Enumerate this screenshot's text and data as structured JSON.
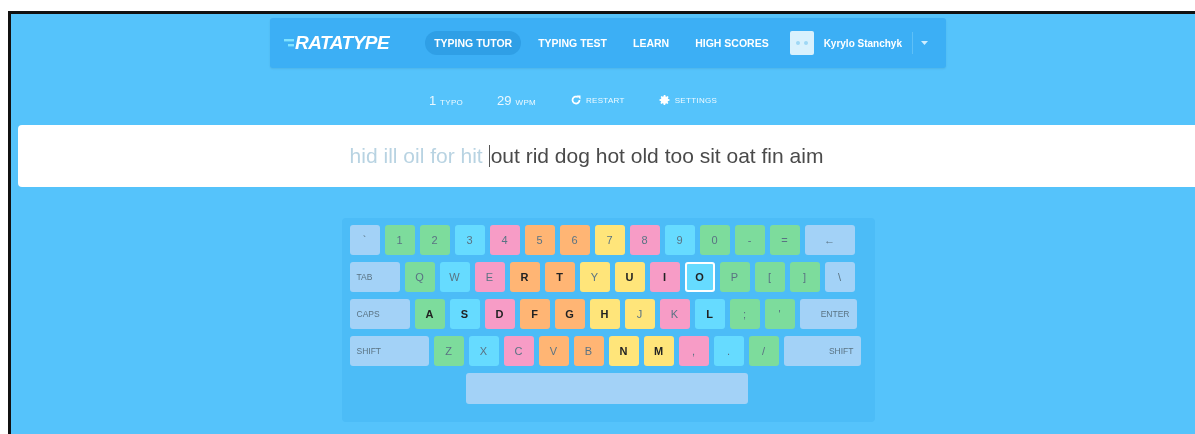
{
  "header": {
    "logo": "RATATYPE",
    "tabs": [
      {
        "label": "TYPING TUTOR",
        "selected": true
      },
      {
        "label": "TYPING TEST",
        "selected": false
      },
      {
        "label": "LEARN",
        "selected": false
      },
      {
        "label": "HIGH SCORES",
        "selected": false
      }
    ],
    "user": {
      "name": "Kyrylo Stanchyk"
    }
  },
  "stats": [
    {
      "kind": "count",
      "value": "1",
      "label": "TYPO"
    },
    {
      "kind": "count",
      "value": "29",
      "label": "WPM"
    },
    {
      "kind": "restart",
      "label": "RESTART"
    },
    {
      "kind": "settings",
      "label": "SETTINGS"
    }
  ],
  "lesson": {
    "typed": "hid ill oil for hit",
    "remaining": "out rid dog hot old too sit oat fin aim"
  },
  "keyboard": {
    "rows": [
      {
        "keys": [
          {
            "label": "`",
            "kind": "char",
            "color": "#a3d2f7",
            "active": false,
            "selected": false
          },
          {
            "label": "1",
            "kind": "char",
            "color": "#7ddc9c",
            "active": false,
            "selected": false
          },
          {
            "label": "2",
            "kind": "char",
            "color": "#7ddc9c",
            "active": false,
            "selected": false
          },
          {
            "label": "3",
            "kind": "char",
            "color": "#66dbff",
            "active": false,
            "selected": false
          },
          {
            "label": "4",
            "kind": "char",
            "color": "#f79cc6",
            "active": false,
            "selected": false
          },
          {
            "label": "5",
            "kind": "char",
            "color": "#ffb574",
            "active": false,
            "selected": false
          },
          {
            "label": "6",
            "kind": "char",
            "color": "#ffb574",
            "active": false,
            "selected": false
          },
          {
            "label": "7",
            "kind": "char",
            "color": "#ffe57a",
            "active": false,
            "selected": false
          },
          {
            "label": "8",
            "kind": "char",
            "color": "#f79cc6",
            "active": false,
            "selected": false
          },
          {
            "label": "9",
            "kind": "char",
            "color": "#66dbff",
            "active": false,
            "selected": false
          },
          {
            "label": "0",
            "kind": "char",
            "color": "#7ddc9c",
            "active": false,
            "selected": false
          },
          {
            "label": "-",
            "kind": "char",
            "color": "#7ddc9c",
            "active": false,
            "selected": false
          },
          {
            "label": "=",
            "kind": "char",
            "color": "#7ddc9c",
            "active": false,
            "selected": false
          },
          {
            "label": "←",
            "kind": "backspace",
            "color": "#a3d2f7",
            "active": false,
            "selected": false
          }
        ]
      },
      {
        "keys": [
          {
            "label": "TAB",
            "kind": "tab",
            "color": "#a3d2f7",
            "active": false,
            "selected": false
          },
          {
            "label": "Q",
            "kind": "char",
            "color": "#7ddc9c",
            "active": false,
            "selected": false
          },
          {
            "label": "W",
            "kind": "char",
            "color": "#66dbff",
            "active": false,
            "selected": false
          },
          {
            "label": "E",
            "kind": "char",
            "color": "#f79cc6",
            "active": false,
            "selected": false
          },
          {
            "label": "R",
            "kind": "char",
            "color": "#ffb574",
            "active": true,
            "selected": false
          },
          {
            "label": "T",
            "kind": "char",
            "color": "#ffb574",
            "active": true,
            "selected": false
          },
          {
            "label": "Y",
            "kind": "char",
            "color": "#ffe57a",
            "active": false,
            "selected": false
          },
          {
            "label": "U",
            "kind": "char",
            "color": "#ffe57a",
            "active": true,
            "selected": false
          },
          {
            "label": "I",
            "kind": "char",
            "color": "#f79cc6",
            "active": true,
            "selected": false
          },
          {
            "label": "O",
            "kind": "char",
            "color": "#66dbff",
            "active": true,
            "selected": true
          },
          {
            "label": "P",
            "kind": "char",
            "color": "#7ddc9c",
            "active": false,
            "selected": false
          },
          {
            "label": "[",
            "kind": "char",
            "color": "#7ddc9c",
            "active": false,
            "selected": false
          },
          {
            "label": "]",
            "kind": "char",
            "color": "#7ddc9c",
            "active": false,
            "selected": false
          },
          {
            "label": "\\",
            "kind": "char",
            "color": "#a3d2f7",
            "active": false,
            "selected": false
          }
        ]
      },
      {
        "keys": [
          {
            "label": "CAPS",
            "kind": "caps",
            "color": "#a3d2f7",
            "active": false,
            "selected": false
          },
          {
            "label": "A",
            "kind": "char",
            "color": "#7ddc9c",
            "active": true,
            "selected": false
          },
          {
            "label": "S",
            "kind": "char",
            "color": "#66dbff",
            "active": true,
            "selected": false
          },
          {
            "label": "D",
            "kind": "char",
            "color": "#f79cc6",
            "active": true,
            "selected": false
          },
          {
            "label": "F",
            "kind": "char",
            "color": "#ffb574",
            "active": true,
            "selected": false
          },
          {
            "label": "G",
            "kind": "char",
            "color": "#ffb574",
            "active": true,
            "selected": false
          },
          {
            "label": "H",
            "kind": "char",
            "color": "#ffe57a",
            "active": true,
            "selected": false
          },
          {
            "label": "J",
            "kind": "char",
            "color": "#ffe57a",
            "active": false,
            "selected": false
          },
          {
            "label": "K",
            "kind": "char",
            "color": "#f79cc6",
            "active": false,
            "selected": false
          },
          {
            "label": "L",
            "kind": "char",
            "color": "#66dbff",
            "active": true,
            "selected": false
          },
          {
            "label": ";",
            "kind": "char",
            "color": "#7ddc9c",
            "active": false,
            "selected": false
          },
          {
            "label": "'",
            "kind": "char",
            "color": "#7ddc9c",
            "active": false,
            "selected": false
          },
          {
            "label": "ENTER",
            "kind": "enter",
            "color": "#a3d2f7",
            "active": false,
            "selected": false
          }
        ]
      },
      {
        "keys": [
          {
            "label": "SHIFT",
            "kind": "shift-left",
            "color": "#a3d2f7",
            "active": false,
            "selected": false
          },
          {
            "label": "Z",
            "kind": "char",
            "color": "#7ddc9c",
            "active": false,
            "selected": false
          },
          {
            "label": "X",
            "kind": "char",
            "color": "#66dbff",
            "active": false,
            "selected": false
          },
          {
            "label": "C",
            "kind": "char",
            "color": "#f79cc6",
            "active": false,
            "selected": false
          },
          {
            "label": "V",
            "kind": "char",
            "color": "#ffb574",
            "active": false,
            "selected": false
          },
          {
            "label": "B",
            "kind": "char",
            "color": "#ffb574",
            "active": false,
            "selected": false
          },
          {
            "label": "N",
            "kind": "char",
            "color": "#ffe57a",
            "active": true,
            "selected": false
          },
          {
            "label": "M",
            "kind": "char",
            "color": "#ffe57a",
            "active": true,
            "selected": false
          },
          {
            "label": ",",
            "kind": "char",
            "color": "#f79cc6",
            "active": false,
            "selected": false
          },
          {
            "label": ".",
            "kind": "char",
            "color": "#66dbff",
            "active": false,
            "selected": false
          },
          {
            "label": "/",
            "kind": "char",
            "color": "#7ddc9c",
            "active": false,
            "selected": false
          },
          {
            "label": "SHIFT",
            "kind": "shift-right",
            "color": "#a3d2f7",
            "active": false,
            "selected": false
          }
        ]
      },
      {
        "keys": [
          {
            "kind": "space",
            "color": "#a3d2f7"
          }
        ]
      }
    ]
  }
}
